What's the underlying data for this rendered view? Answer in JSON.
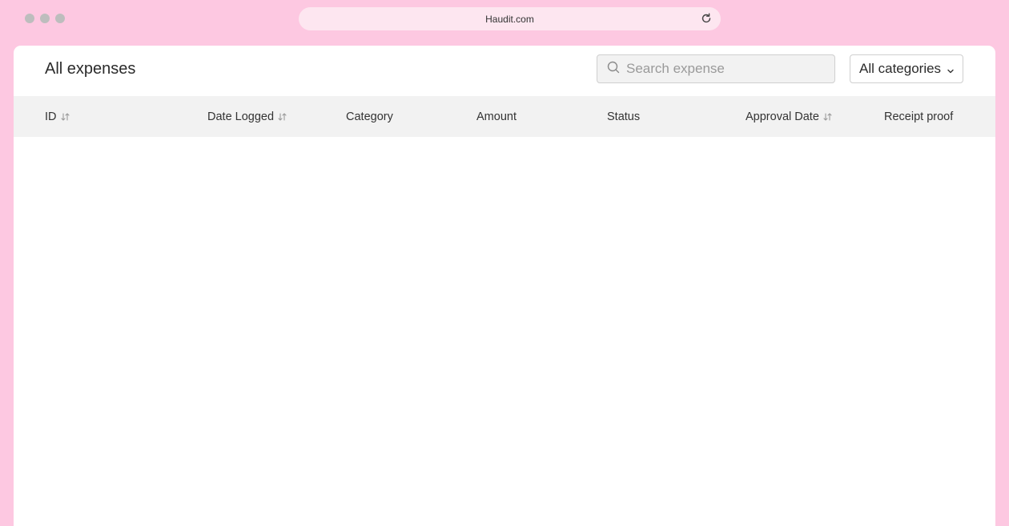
{
  "browser": {
    "url": "Haudit.com"
  },
  "page": {
    "title": "All expenses"
  },
  "search": {
    "placeholder": "Search expense",
    "value": ""
  },
  "filter": {
    "selected": "All categories"
  },
  "table": {
    "columns": [
      {
        "label": "ID",
        "sortable": true
      },
      {
        "label": "Date Logged",
        "sortable": true
      },
      {
        "label": "Category",
        "sortable": false
      },
      {
        "label": "Amount",
        "sortable": false
      },
      {
        "label": "Status",
        "sortable": false
      },
      {
        "label": "Approval Date",
        "sortable": true
      },
      {
        "label": "Receipt proof",
        "sortable": false
      }
    ],
    "rows": []
  },
  "icons": {
    "window_controls": "traffic-lights-icon",
    "reload": "reload-icon",
    "search": "search-icon",
    "dropdown": "chevron-down-icon",
    "sort": "sort-icon"
  },
  "colors": {
    "background": "#fdc8e1",
    "urlbar": "#fde6f0",
    "header_row": "#f2f2f2"
  }
}
